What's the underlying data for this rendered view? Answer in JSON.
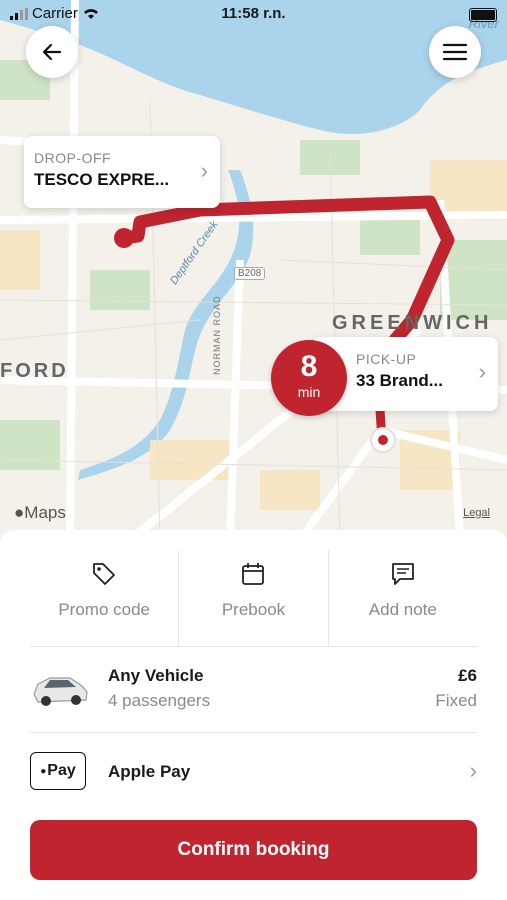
{
  "status_bar": {
    "carrier": "Carrier",
    "time": "11:58 r.n."
  },
  "map": {
    "labels": {
      "river": "River",
      "greenwich": "GREENWICH",
      "ford": "FORD",
      "deptford_creek": "Deptford Creek",
      "norman_road": "NORMAN ROAD",
      "b208": "B208"
    },
    "maps_logo": "Maps",
    "legal": "Legal",
    "dropoff": {
      "label": "DROP-OFF",
      "value": "TESCO EXPRE..."
    },
    "pickup": {
      "label": "PICK-UP",
      "value": "33 Brand..."
    },
    "eta": {
      "value": "8",
      "unit": "min"
    },
    "route_color": "#c0252f"
  },
  "actions": [
    {
      "icon": "tag-icon",
      "label": "Promo code"
    },
    {
      "icon": "calendar-icon",
      "label": "Prebook"
    },
    {
      "icon": "note-icon",
      "label": "Add note"
    }
  ],
  "vehicle": {
    "name": "Any Vehicle",
    "passengers": "4 passengers",
    "price": "£6",
    "price_type": "Fixed"
  },
  "payment": {
    "badge": "Pay",
    "name": "Apple Pay"
  },
  "confirm_label": "Confirm booking",
  "colors": {
    "accent": "#c0252f",
    "water": "#aad3ec",
    "park": "#cfe4c4"
  }
}
